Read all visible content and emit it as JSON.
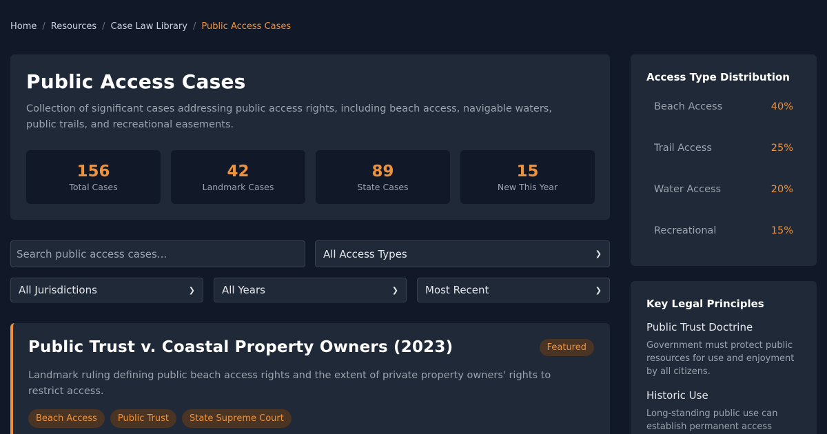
{
  "breadcrumb": {
    "items": [
      "Home",
      "Resources",
      "Case Law Library"
    ],
    "separator": "/",
    "current": "Public Access Cases"
  },
  "hero": {
    "title": "Public Access Cases",
    "description": "Collection of significant cases addressing public access rights, including beach access, navigable waters, public trails, and recreational easements.",
    "stats": [
      {
        "value": "156",
        "label": "Total Cases"
      },
      {
        "value": "42",
        "label": "Landmark Cases"
      },
      {
        "value": "89",
        "label": "State Cases"
      },
      {
        "value": "15",
        "label": "New This Year"
      }
    ]
  },
  "filters": {
    "search_placeholder": "Search public access cases...",
    "access_type": "All Access Types",
    "jurisdiction": "All Jurisdictions",
    "years": "All Years",
    "sort": "Most Recent"
  },
  "case": {
    "title": "Public Trust v. Coastal Property Owners (2023)",
    "badge": "Featured",
    "description": "Landmark ruling defining public beach access rights and the extent of private property owners' rights to restrict access.",
    "tags": [
      "Beach Access",
      "Public Trust",
      "State Supreme Court"
    ]
  },
  "distribution": {
    "title": "Access Type Distribution",
    "rows": [
      {
        "name": "Beach Access",
        "pct": "40%"
      },
      {
        "name": "Trail Access",
        "pct": "25%"
      },
      {
        "name": "Water Access",
        "pct": "20%"
      },
      {
        "name": "Recreational",
        "pct": "15%"
      }
    ]
  },
  "principles": {
    "title": "Key Legal Principles",
    "items": [
      {
        "name": "Public Trust Doctrine",
        "desc": "Government must protect public resources for use and enjoyment by all citizens."
      },
      {
        "name": "Historic Use",
        "desc": "Long-standing public use can establish permanent access rights."
      }
    ]
  },
  "colors": {
    "accent": "#f0923a",
    "background": "#111827",
    "card": "#1f2937"
  }
}
